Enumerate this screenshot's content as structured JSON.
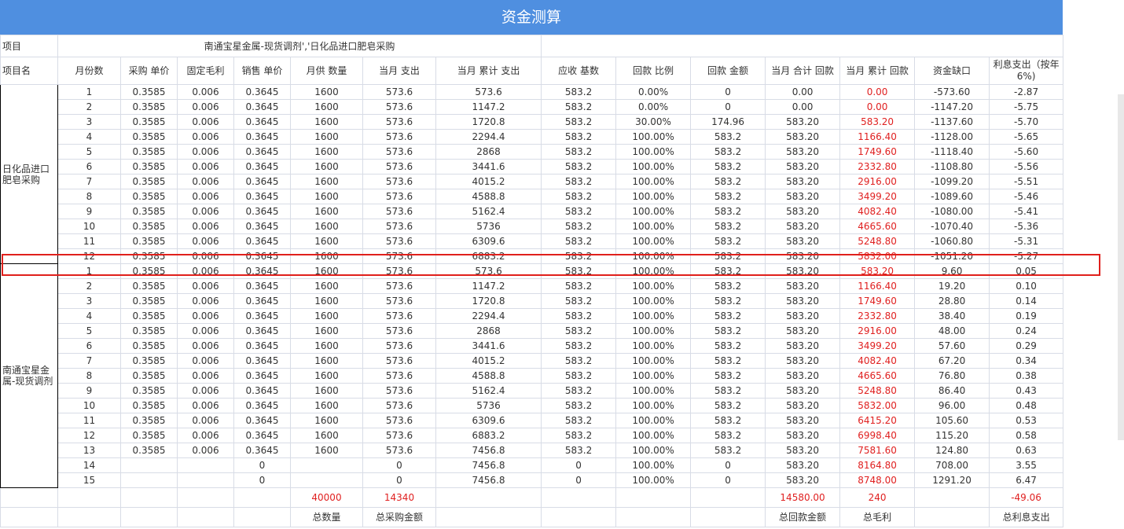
{
  "title": "资金测算",
  "project_row": {
    "label": "项目",
    "value": "南通宝星金属-现货调剂','日化品进口肥皂采购"
  },
  "headers": [
    "项目名",
    "月份数",
    "采购 单价",
    "固定毛利",
    "销售 单价",
    "月供 数量",
    "当月 支出",
    "当月 累计 支出",
    "应收 基数",
    "回款 比例",
    "回款 金额",
    "当月 合计 回款",
    "当月 累计 回款",
    "资金缺口",
    "利息支出（按年6%)"
  ],
  "groups": [
    {
      "name": "日化品进口肥皂采购",
      "rows": 12
    },
    {
      "name": "南通宝星金属-现货调剂",
      "rows": 15
    }
  ],
  "rows": [
    [
      "1",
      "0.3585",
      "0.006",
      "0.3645",
      "1600",
      "573.6",
      "573.6",
      "583.2",
      "0.00%",
      "0",
      "0.00",
      "0.00",
      "-573.60",
      "-2.87"
    ],
    [
      "2",
      "0.3585",
      "0.006",
      "0.3645",
      "1600",
      "573.6",
      "1147.2",
      "583.2",
      "0.00%",
      "0",
      "0.00",
      "0.00",
      "-1147.20",
      "-5.75"
    ],
    [
      "3",
      "0.3585",
      "0.006",
      "0.3645",
      "1600",
      "573.6",
      "1720.8",
      "583.2",
      "30.00%",
      "174.96",
      "583.20",
      "583.20",
      "-1137.60",
      "-5.70"
    ],
    [
      "4",
      "0.3585",
      "0.006",
      "0.3645",
      "1600",
      "573.6",
      "2294.4",
      "583.2",
      "100.00%",
      "583.2",
      "583.20",
      "1166.40",
      "-1128.00",
      "-5.65"
    ],
    [
      "5",
      "0.3585",
      "0.006",
      "0.3645",
      "1600",
      "573.6",
      "2868",
      "583.2",
      "100.00%",
      "583.2",
      "583.20",
      "1749.60",
      "-1118.40",
      "-5.60"
    ],
    [
      "6",
      "0.3585",
      "0.006",
      "0.3645",
      "1600",
      "573.6",
      "3441.6",
      "583.2",
      "100.00%",
      "583.2",
      "583.20",
      "2332.80",
      "-1108.80",
      "-5.56"
    ],
    [
      "7",
      "0.3585",
      "0.006",
      "0.3645",
      "1600",
      "573.6",
      "4015.2",
      "583.2",
      "100.00%",
      "583.2",
      "583.20",
      "2916.00",
      "-1099.20",
      "-5.51"
    ],
    [
      "8",
      "0.3585",
      "0.006",
      "0.3645",
      "1600",
      "573.6",
      "4588.8",
      "583.2",
      "100.00%",
      "583.2",
      "583.20",
      "3499.20",
      "-1089.60",
      "-5.46"
    ],
    [
      "9",
      "0.3585",
      "0.006",
      "0.3645",
      "1600",
      "573.6",
      "5162.4",
      "583.2",
      "100.00%",
      "583.2",
      "583.20",
      "4082.40",
      "-1080.00",
      "-5.41"
    ],
    [
      "10",
      "0.3585",
      "0.006",
      "0.3645",
      "1600",
      "573.6",
      "5736",
      "583.2",
      "100.00%",
      "583.2",
      "583.20",
      "4665.60",
      "-1070.40",
      "-5.36"
    ],
    [
      "11",
      "0.3585",
      "0.006",
      "0.3645",
      "1600",
      "573.6",
      "6309.6",
      "583.2",
      "100.00%",
      "583.2",
      "583.20",
      "5248.80",
      "-1060.80",
      "-5.31"
    ],
    [
      "12",
      "0.3585",
      "0.006",
      "0.3645",
      "1600",
      "573.6",
      "6883.2",
      "583.2",
      "100.00%",
      "583.2",
      "583.20",
      "5832.00",
      "-1051.20",
      "-5.27"
    ],
    [
      "1",
      "0.3585",
      "0.006",
      "0.3645",
      "1600",
      "573.6",
      "573.6",
      "583.2",
      "100.00%",
      "583.2",
      "583.20",
      "583.20",
      "9.60",
      "0.05"
    ],
    [
      "2",
      "0.3585",
      "0.006",
      "0.3645",
      "1600",
      "573.6",
      "1147.2",
      "583.2",
      "100.00%",
      "583.2",
      "583.20",
      "1166.40",
      "19.20",
      "0.10"
    ],
    [
      "3",
      "0.3585",
      "0.006",
      "0.3645",
      "1600",
      "573.6",
      "1720.8",
      "583.2",
      "100.00%",
      "583.2",
      "583.20",
      "1749.60",
      "28.80",
      "0.14"
    ],
    [
      "4",
      "0.3585",
      "0.006",
      "0.3645",
      "1600",
      "573.6",
      "2294.4",
      "583.2",
      "100.00%",
      "583.2",
      "583.20",
      "2332.80",
      "38.40",
      "0.19"
    ],
    [
      "5",
      "0.3585",
      "0.006",
      "0.3645",
      "1600",
      "573.6",
      "2868",
      "583.2",
      "100.00%",
      "583.2",
      "583.20",
      "2916.00",
      "48.00",
      "0.24"
    ],
    [
      "6",
      "0.3585",
      "0.006",
      "0.3645",
      "1600",
      "573.6",
      "3441.6",
      "583.2",
      "100.00%",
      "583.2",
      "583.20",
      "3499.20",
      "57.60",
      "0.29"
    ],
    [
      "7",
      "0.3585",
      "0.006",
      "0.3645",
      "1600",
      "573.6",
      "4015.2",
      "583.2",
      "100.00%",
      "583.2",
      "583.20",
      "4082.40",
      "67.20",
      "0.34"
    ],
    [
      "8",
      "0.3585",
      "0.006",
      "0.3645",
      "1600",
      "573.6",
      "4588.8",
      "583.2",
      "100.00%",
      "583.2",
      "583.20",
      "4665.60",
      "76.80",
      "0.38"
    ],
    [
      "9",
      "0.3585",
      "0.006",
      "0.3645",
      "1600",
      "573.6",
      "5162.4",
      "583.2",
      "100.00%",
      "583.2",
      "583.20",
      "5248.80",
      "86.40",
      "0.43"
    ],
    [
      "10",
      "0.3585",
      "0.006",
      "0.3645",
      "1600",
      "573.6",
      "5736",
      "583.2",
      "100.00%",
      "583.2",
      "583.20",
      "5832.00",
      "96.00",
      "0.48"
    ],
    [
      "11",
      "0.3585",
      "0.006",
      "0.3645",
      "1600",
      "573.6",
      "6309.6",
      "583.2",
      "100.00%",
      "583.2",
      "583.20",
      "6415.20",
      "105.60",
      "0.53"
    ],
    [
      "12",
      "0.3585",
      "0.006",
      "0.3645",
      "1600",
      "573.6",
      "6883.2",
      "583.2",
      "100.00%",
      "583.2",
      "583.20",
      "6998.40",
      "115.20",
      "0.58"
    ],
    [
      "13",
      "0.3585",
      "0.006",
      "0.3645",
      "1600",
      "573.6",
      "7456.8",
      "583.2",
      "100.00%",
      "583.2",
      "583.20",
      "7581.60",
      "124.80",
      "0.63"
    ],
    [
      "14",
      "",
      "",
      "0",
      "",
      "0",
      "7456.8",
      "0",
      "100.00%",
      "0",
      "583.20",
      "8164.80",
      "708.00",
      "3.55"
    ],
    [
      "15",
      "",
      "",
      "0",
      "",
      "0",
      "7456.8",
      "0",
      "100.00%",
      "0",
      "583.20",
      "8748.00",
      "1291.20",
      "6.47"
    ]
  ],
  "totals": {
    "total_qty": "40000",
    "total_purchase": "14340",
    "total_receipt": "14580.00",
    "total_margin": "240",
    "total_interest": "-49.06"
  },
  "total_labels": {
    "total_qty": "总数量",
    "total_purchase": "总采购金额",
    "total_receipt": "总回款金额",
    "total_margin": "总毛利",
    "total_interest": "总利息支出"
  },
  "colors": {
    "title_bg": "#4f8fe0",
    "negative": "#e02020",
    "highlight": "#e0201c",
    "grid": "#d8dce6"
  }
}
